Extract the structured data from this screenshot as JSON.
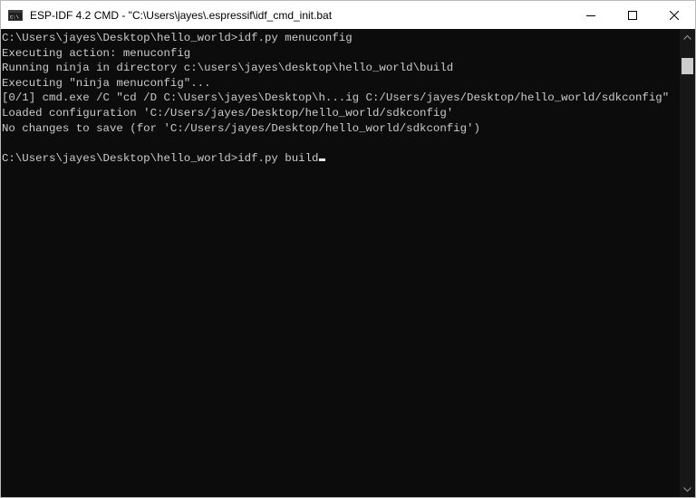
{
  "window": {
    "title": "ESP-IDF 4.2 CMD - \"C:\\Users\\jayes\\.espressif\\idf_cmd_init.bat",
    "icon": "console-app-icon",
    "buttons": {
      "minimize": "minimize-icon",
      "maximize": "maximize-icon",
      "close": "close-icon"
    }
  },
  "console": {
    "lines": [
      "C:\\Users\\jayes\\Desktop\\hello_world>idf.py menuconfig",
      "Executing action: menuconfig",
      "Running ninja in directory c:\\users\\jayes\\desktop\\hello_world\\build",
      "Executing \"ninja menuconfig\"...",
      "[0/1] cmd.exe /C \"cd /D C:\\Users\\jayes\\Desktop\\h...ig C:/Users/jayes/Desktop/hello_world/sdkconfig\"",
      "Loaded configuration 'C:/Users/jayes/Desktop/hello_world/sdkconfig'",
      "No changes to save (for 'C:/Users/jayes/Desktop/hello_world/sdkconfig')",
      "",
      "C:\\Users\\jayes\\Desktop\\hello_world>idf.py build"
    ],
    "text_color": "#cccccc",
    "background": "#0c0c0c"
  }
}
